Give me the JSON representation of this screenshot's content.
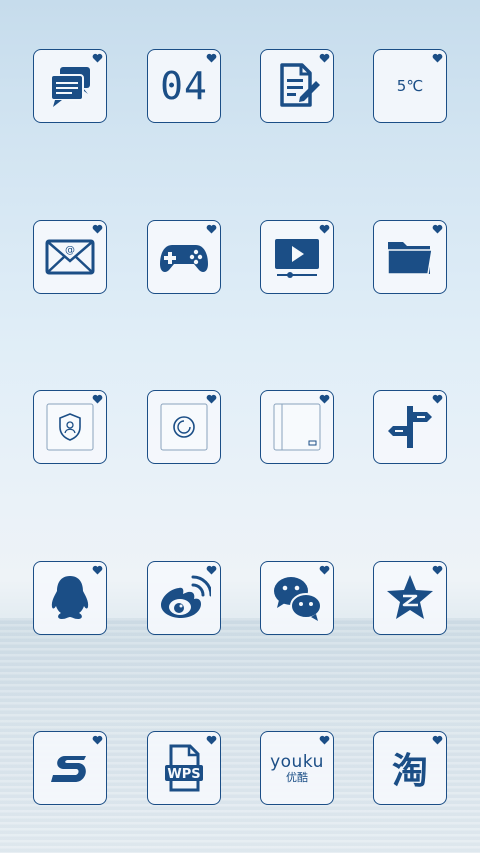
{
  "theme": {
    "accent": "#1b4e86",
    "tile_bg": "#f4f8fc"
  },
  "rows": [
    [
      {
        "name": "messages",
        "icon": "message-bubbles-icon"
      },
      {
        "name": "calendar",
        "icon": "calendar-date-text",
        "text": "04"
      },
      {
        "name": "notes",
        "icon": "document-pencil-icon"
      },
      {
        "name": "weather",
        "icon": "weather-text",
        "text": "5℃"
      }
    ],
    [
      {
        "name": "email",
        "icon": "envelope-at-icon"
      },
      {
        "name": "games",
        "icon": "gamepad-icon"
      },
      {
        "name": "video-player",
        "icon": "play-screen-icon"
      },
      {
        "name": "file-manager",
        "icon": "folder-icon"
      }
    ],
    [
      {
        "name": "security",
        "icon": "shield-icon"
      },
      {
        "name": "updater",
        "icon": "refresh-circle-icon"
      },
      {
        "name": "gallery",
        "icon": "frame-icon"
      },
      {
        "name": "navigation",
        "icon": "signpost-icon"
      }
    ],
    [
      {
        "name": "qq",
        "icon": "penguin-icon"
      },
      {
        "name": "weibo",
        "icon": "weibo-eye-icon"
      },
      {
        "name": "wechat",
        "icon": "wechat-bubbles-icon"
      },
      {
        "name": "qzone",
        "icon": "star-z-icon"
      }
    ],
    [
      {
        "name": "sogou",
        "icon": "s-logo-icon"
      },
      {
        "name": "wps",
        "icon": "wps-document-icon",
        "text": "WPS"
      },
      {
        "name": "youku",
        "icon": "youku-logo-text",
        "text": "youku",
        "subtext": "优酷"
      },
      {
        "name": "taobao",
        "icon": "taobao-logo-text",
        "text": "淘"
      }
    ]
  ]
}
